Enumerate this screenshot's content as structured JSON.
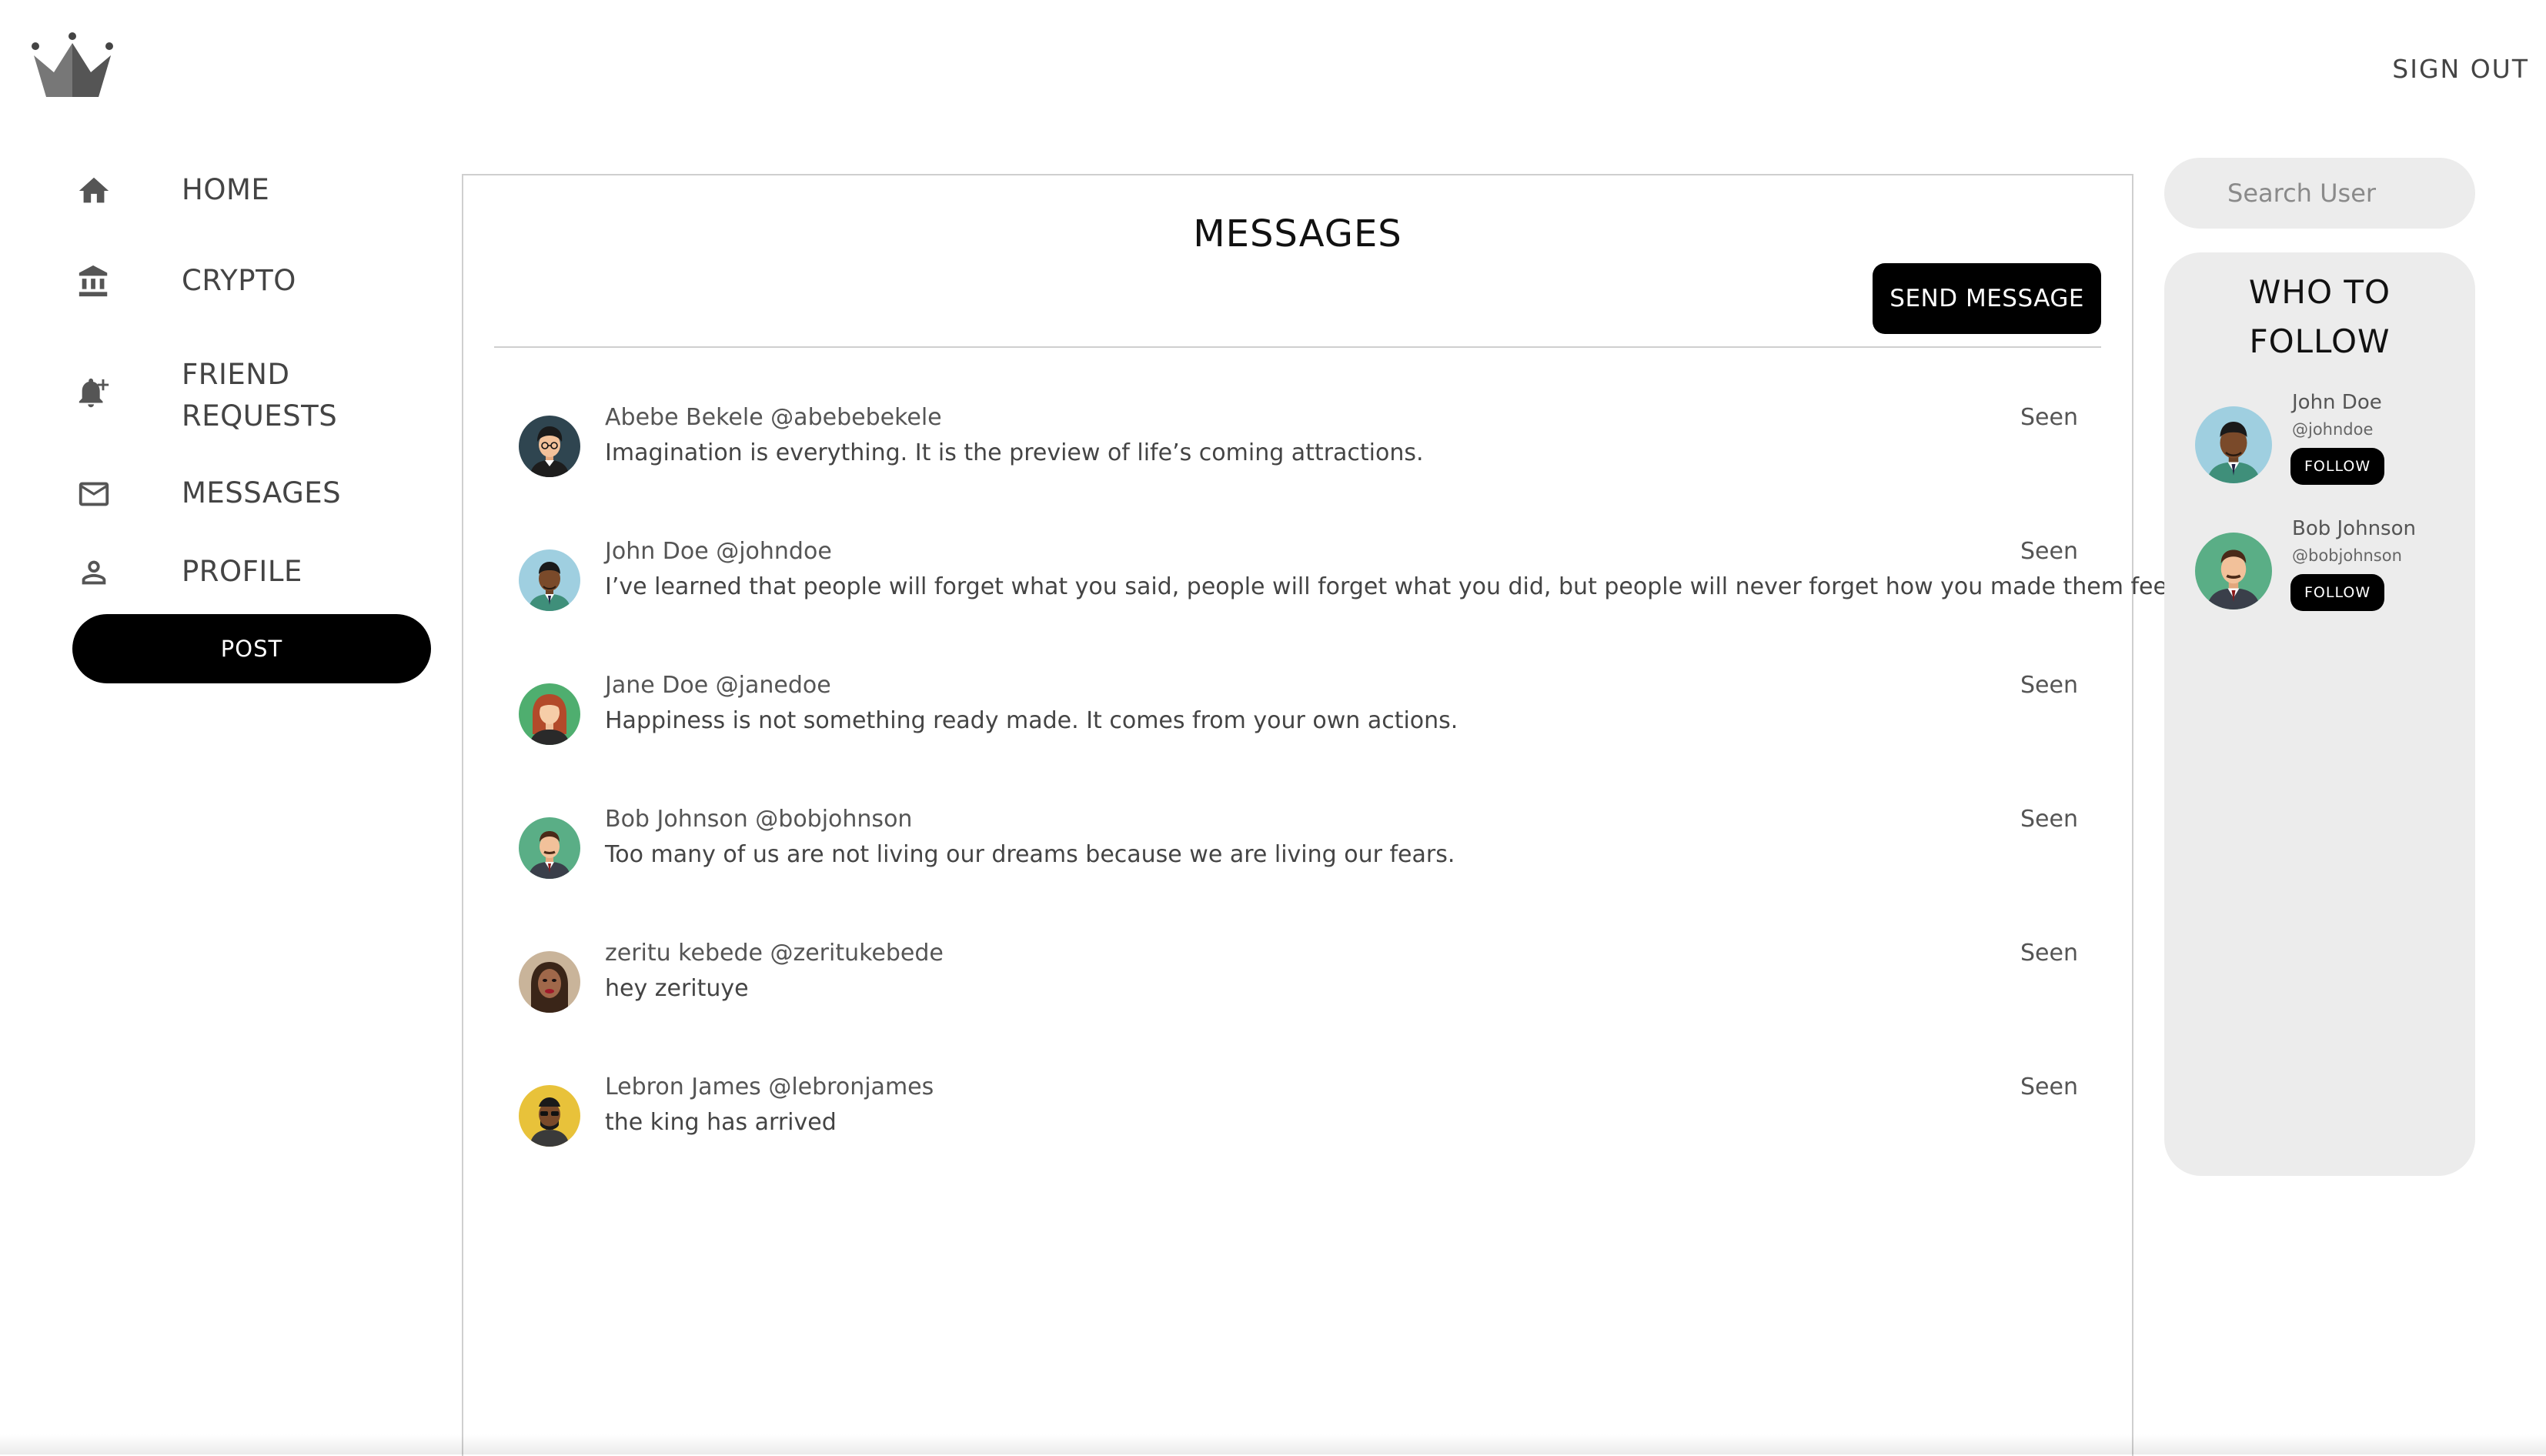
{
  "header": {
    "logo_icon": "crown-icon",
    "signout_label": "SIGN OUT"
  },
  "nav": {
    "items": [
      {
        "label": "HOME",
        "icon": "home-icon"
      },
      {
        "label": "CRYPTO",
        "icon": "bank-icon"
      },
      {
        "label": "FRIEND REQUESTS",
        "icon": "bell-plus-icon"
      },
      {
        "label": "MESSAGES",
        "icon": "mail-icon"
      },
      {
        "label": "PROFILE",
        "icon": "person-icon"
      }
    ],
    "post_label": "POST"
  },
  "messages": {
    "title": "MESSAGES",
    "send_label": "SEND MESSAGE",
    "items": [
      {
        "name": "Abebe Bekele @abebebekele",
        "text": "Imagination is everything. It is the preview of life’s coming attractions.",
        "status": "Seen"
      },
      {
        "name": "John Doe @johndoe",
        "text": "I’ve learned that people will forget what you said, people will forget what you did, but people will never forget how you made them feel.",
        "status": "Seen"
      },
      {
        "name": "Jane Doe @janedoe",
        "text": "Happiness is not something ready made. It comes from your own actions.",
        "status": "Seen"
      },
      {
        "name": "Bob Johnson @bobjohnson",
        "text": "Too many of us are not living our dreams because we are living our fears.",
        "status": "Seen"
      },
      {
        "name": "zeritu kebede @zeritukebede",
        "text": "hey zerituye",
        "status": "Seen"
      },
      {
        "name": "Lebron James @lebronjames",
        "text": "the king has arrived",
        "status": "Seen"
      }
    ]
  },
  "search": {
    "placeholder": "Search User"
  },
  "who_to_follow": {
    "title": "WHO TO FOLLOW",
    "users": [
      {
        "name": "John Doe",
        "handle": "@johndoe",
        "follow_label": "FOLLOW"
      },
      {
        "name": "Bob Johnson",
        "handle": "@bobjohnson",
        "follow_label": "FOLLOW"
      }
    ]
  },
  "colors": {
    "button_bg": "#000000",
    "panel_border": "#cfcfcf",
    "sidebar_bg": "#ececec"
  }
}
